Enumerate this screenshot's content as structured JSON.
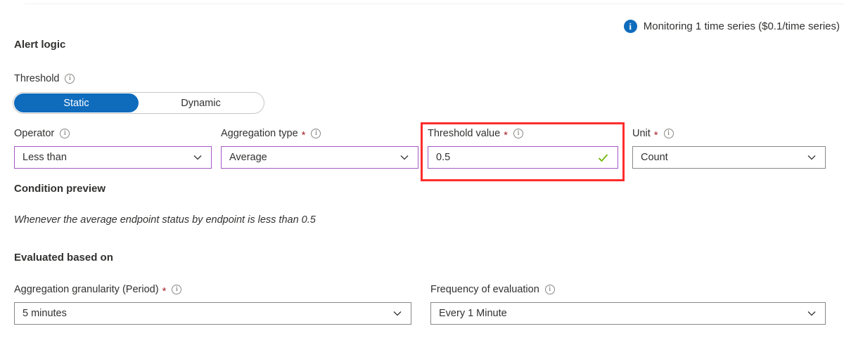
{
  "notice": {
    "icon": "info-circle-filled-icon",
    "text": "Monitoring 1 time series ($0.1/time series)"
  },
  "sections": {
    "alert_logic": "Alert logic",
    "condition_preview": "Condition preview",
    "evaluated_based_on": "Evaluated based on"
  },
  "threshold": {
    "label": "Threshold",
    "info_icon": "info-circle-outline-icon",
    "options": [
      "Static",
      "Dynamic"
    ],
    "selected": "Static"
  },
  "operator": {
    "label": "Operator",
    "info_icon": "info-circle-outline-icon",
    "value": "Less than",
    "chevron_icon": "chevron-down-icon"
  },
  "aggregation_type": {
    "label": "Aggregation type",
    "required": "*",
    "info_icon": "info-circle-outline-icon",
    "value": "Average",
    "chevron_icon": "chevron-down-icon"
  },
  "threshold_value": {
    "label": "Threshold value",
    "required": "*",
    "info_icon": "info-circle-outline-icon",
    "value": "0.5",
    "validation_icon": "check-mark-icon"
  },
  "unit": {
    "label": "Unit",
    "required": "*",
    "info_icon": "info-circle-outline-icon",
    "value": "Count",
    "chevron_icon": "chevron-down-icon"
  },
  "condition_preview_text": "Whenever the average endpoint status by endpoint is less than 0.5",
  "aggregation_granularity": {
    "label": "Aggregation granularity (Period)",
    "required": "*",
    "info_icon": "info-circle-outline-icon",
    "value": "5 minutes",
    "chevron_icon": "chevron-down-icon"
  },
  "frequency": {
    "label": "Frequency of evaluation",
    "info_icon": "info-circle-outline-icon",
    "value": "Every 1 Minute",
    "chevron_icon": "chevron-down-icon"
  },
  "colors": {
    "accent_blue": "#0f6cbd",
    "field_focus_purple": "#a457c4",
    "field_border_gray": "#8a8886",
    "required_red": "#a4262c",
    "annotation_red": "#ff2d2d",
    "validation_green": "#6bb700"
  }
}
